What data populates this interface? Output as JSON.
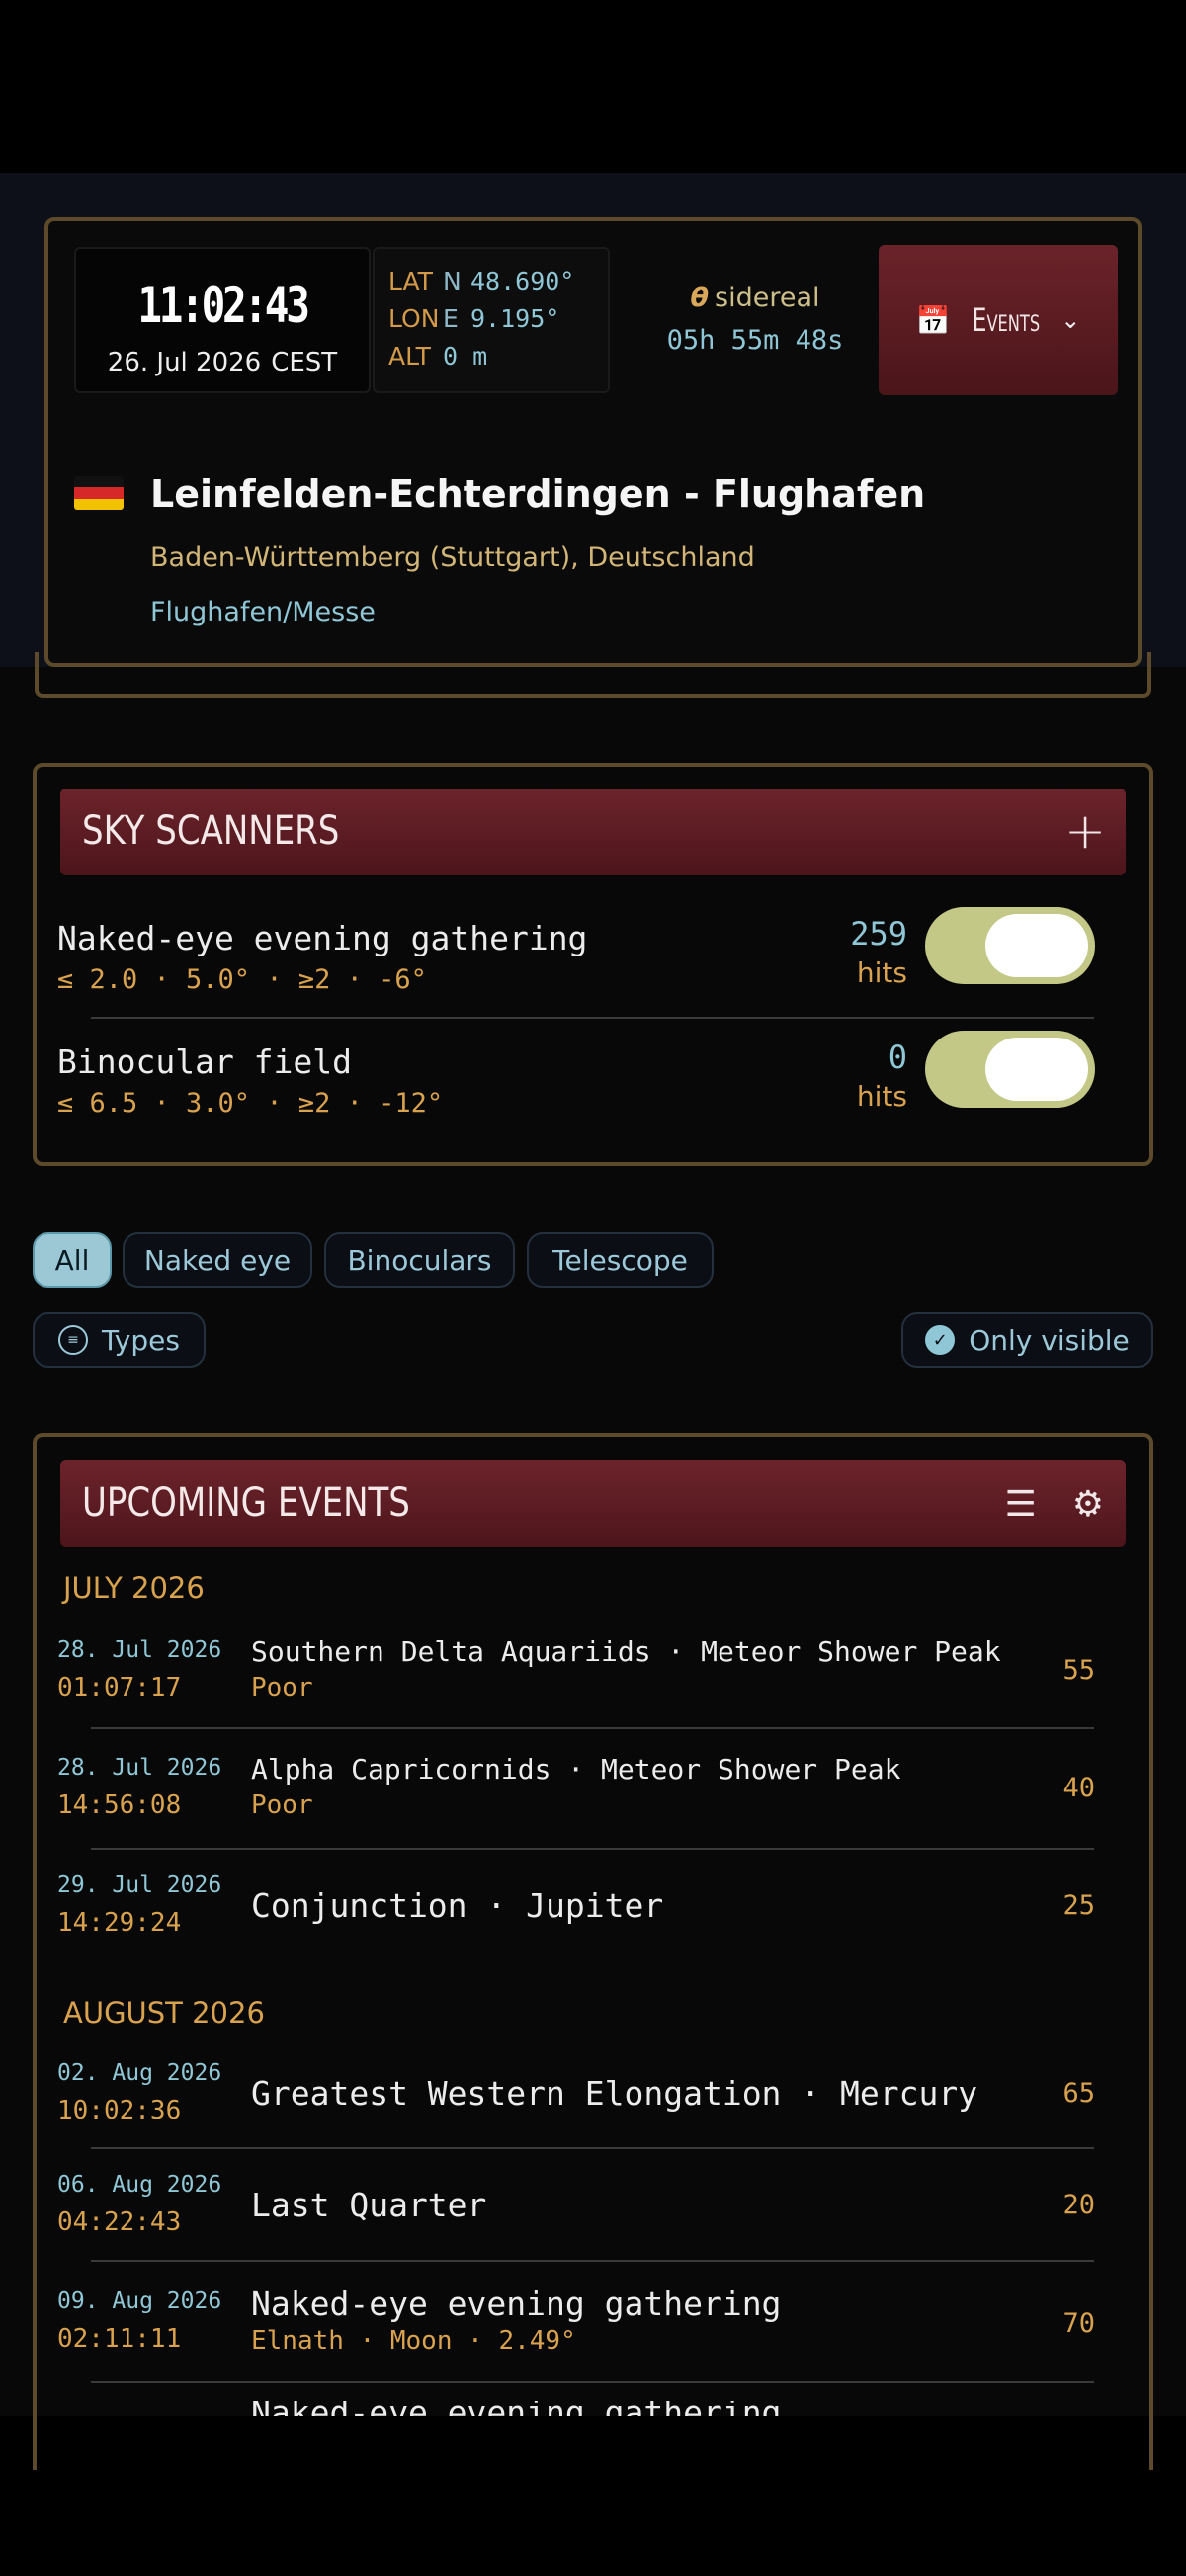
{
  "header": {
    "time": "11:02:43",
    "date": "26. Jul 2026",
    "timezone": "CEST",
    "lat_label": "LAT",
    "lat_hemi": "N",
    "lat_value": "48.690°",
    "lon_label": "LON",
    "lon_hemi": "E",
    "lon_value": "9.195°",
    "alt_label": "ALT",
    "alt_value": "0 m",
    "sidereal_symbol": "θ",
    "sidereal_label": "sidereal",
    "sidereal_value": "05h 55m 48s",
    "events_button": "Events",
    "location_title": "Leinfelden-Echterdingen - Flughafen",
    "location_region": "Baden-Württemberg (Stuttgart), Deutschland",
    "location_detail": "Flughafen/Messe"
  },
  "scanners": {
    "title": "SKY SCANNERS",
    "items": [
      {
        "name": "Naked-eye evening gathering",
        "params": "≤ 2.0 · 5.0° · ≥2 · -6°",
        "hits": "259",
        "hits_label": "hits",
        "enabled": true
      },
      {
        "name": "Binocular field",
        "params": "≤ 6.5 · 3.0° · ≥2 · -12°",
        "hits": "0",
        "hits_label": "hits",
        "enabled": true
      }
    ]
  },
  "filters": {
    "tabs": [
      "All",
      "Naked eye",
      "Binoculars",
      "Telescope"
    ],
    "active_tab": "All",
    "types_label": "Types",
    "only_visible_label": "Only visible"
  },
  "upcoming": {
    "title": "UPCOMING EVENTS",
    "months": [
      "JULY 2026",
      "AUGUST 2026"
    ],
    "events": [
      {
        "date": "28. Jul 2026",
        "time": "01:07:17",
        "title": "Southern Delta Aquariids · Meteor Shower Peak",
        "sub": "Poor",
        "score": "55"
      },
      {
        "date": "28. Jul 2026",
        "time": "14:56:08",
        "title": "Alpha Capricornids · Meteor Shower Peak",
        "sub": "Poor",
        "score": "40"
      },
      {
        "date": "29. Jul 2026",
        "time": "14:29:24",
        "title": "Conjunction · Jupiter",
        "sub": "",
        "score": "25"
      },
      {
        "date": "02. Aug 2026",
        "time": "10:02:36",
        "title": "Greatest Western Elongation · Mercury",
        "sub": "",
        "score": "65"
      },
      {
        "date": "06. Aug 2026",
        "time": "04:22:43",
        "title": "Last Quarter",
        "sub": "",
        "score": "20"
      },
      {
        "date": "09. Aug 2026",
        "time": "02:11:11",
        "title": "Naked-eye evening gathering",
        "sub": "Elnath · Moon · 2.49°",
        "score": "70"
      },
      {
        "date": "",
        "time": "",
        "title": "Naked-eye evening gathering",
        "sub": "",
        "score": ""
      }
    ]
  },
  "colors": {
    "accent_red": "#6d232b",
    "gold": "#d9a24e",
    "cyan": "#8fc7d6",
    "toggle_on": "#c3c887",
    "card_border": "#5d4a2a"
  }
}
